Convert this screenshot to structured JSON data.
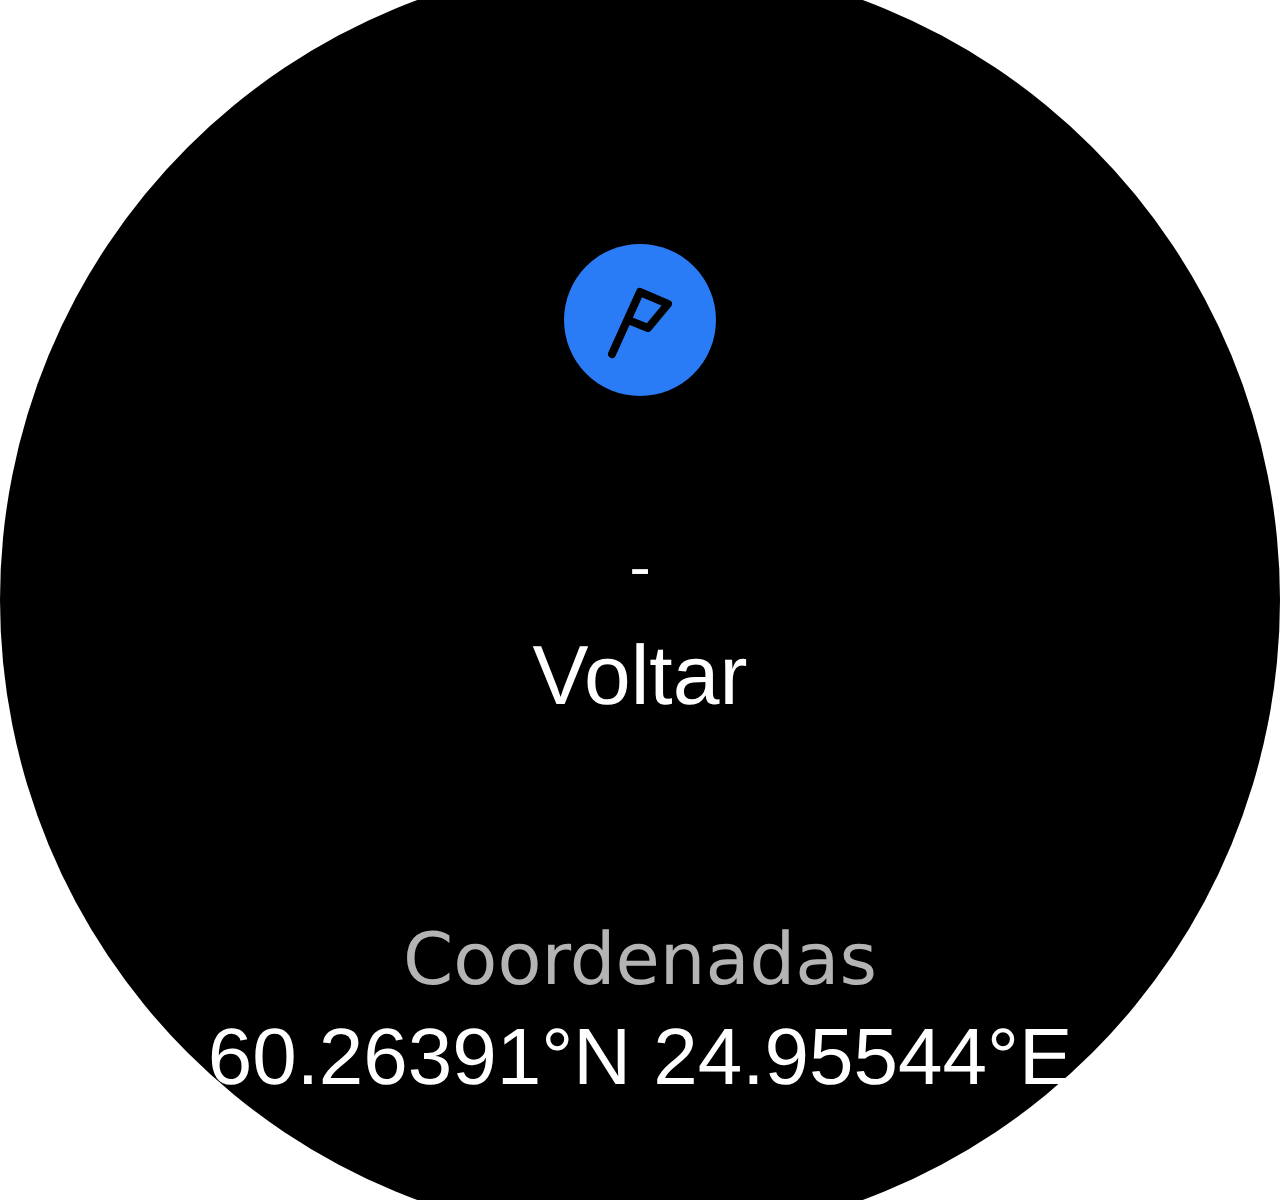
{
  "waypoint": {
    "value": "-",
    "name": "Voltar"
  },
  "coordinates": {
    "label": "Coordenadas",
    "value": "60.26391°N 24.95544°E"
  }
}
